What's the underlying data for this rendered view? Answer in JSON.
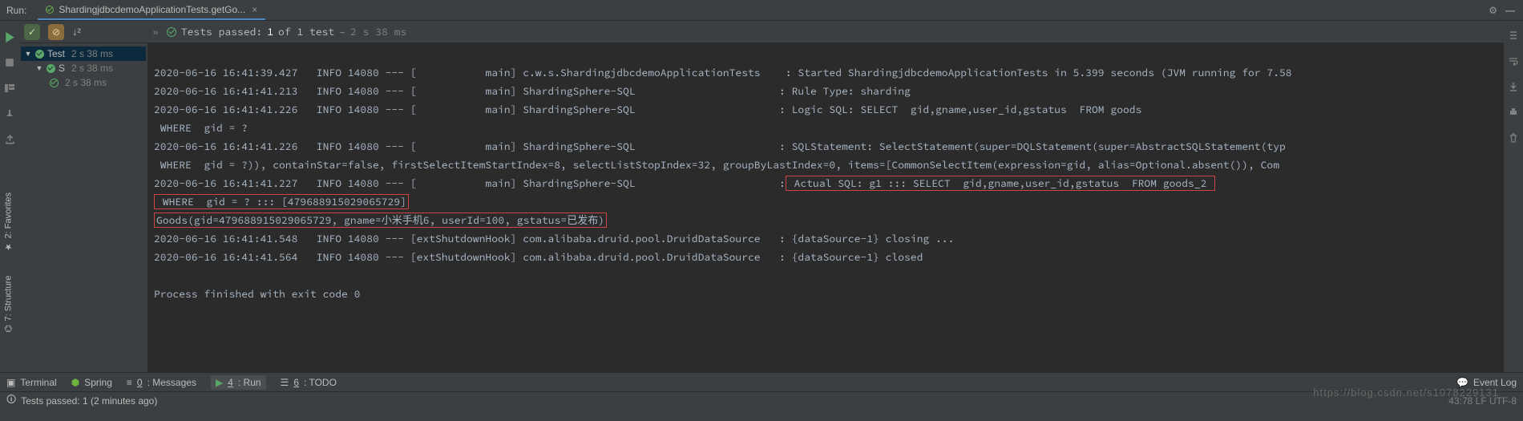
{
  "header": {
    "run_label": "Run:",
    "tab_title": "ShardingjdbcdemoApplicationTests.getGo...",
    "close": "×",
    "gear": "⚙",
    "min": "—"
  },
  "summary": {
    "prefix": "Tests passed:",
    "count": "1",
    "of": "of 1 test",
    "dash": "–",
    "duration": "2 s 38 ms",
    "sort": "↓²",
    "arrows": "»"
  },
  "tree": {
    "root": {
      "label": "Test",
      "duration": "2 s 38 ms"
    },
    "child": {
      "label": "S",
      "duration": "2 s 38 ms"
    },
    "leaf": {
      "duration": "2 s 38 ms"
    }
  },
  "console": {
    "l1": "2020-06-16 16:41:39.427   INFO 14080 --- [           main] c.w.s.ShardingjdbcdemoApplicationTests    : Started ShardingjdbcdemoApplicationTests in 5.399 seconds (JVM running for 7.58",
    "l2": "2020-06-16 16:41:41.213   INFO 14080 --- [           main] ShardingSphere-SQL                       : Rule Type: sharding",
    "l3": "2020-06-16 16:41:41.226   INFO 14080 --- [           main] ShardingSphere-SQL                       : Logic SQL: SELECT  gid,gname,user_id,gstatus  FROM goods ",
    "l4": " WHERE  gid = ?",
    "l5": "2020-06-16 16:41:41.226   INFO 14080 --- [           main] ShardingSphere-SQL                       : SQLStatement: SelectStatement(super=DQLStatement(super=AbstractSQLStatement(typ",
    "l6": " WHERE  gid = ?)), containStar=false, firstSelectItemStartIndex=8, selectListStopIndex=32, groupByLastIndex=0, items=[CommonSelectItem(expression=gid, alias=Optional.absent()), Com",
    "l7a": "2020-06-16 16:41:41.227   INFO 14080 --- [           main] ShardingSphere-SQL                       :",
    "l7b": " Actual SQL: g1 ::: SELECT  gid,gname,user_id,gstatus  FROM goods_2 ",
    "l8": " WHERE  gid = ? ::: [479688915029065729]",
    "l9": "Goods(gid=479688915029065729, gname=小米手机6, userId=100, gstatus=已发布)",
    "l10": "2020-06-16 16:41:41.548   INFO 14080 --- [extShutdownHook] com.alibaba.druid.pool.DruidDataSource   : {dataSource-1} closing ...",
    "l11": "2020-06-16 16:41:41.564   INFO 14080 --- [extShutdownHook] com.alibaba.druid.pool.DruidDataSource   : {dataSource-1} closed",
    "l12": "",
    "l13": "Process finished with exit code 0"
  },
  "bottom_tabs": {
    "terminal": "Terminal",
    "spring": "Spring",
    "messages_num": "0",
    "messages": ": Messages",
    "run_num": "4",
    "run": ": Run",
    "todo_num": "6",
    "todo": ": TODO",
    "event_log": "Event Log"
  },
  "status": {
    "msg": "Tests passed: 1 (2 minutes ago)",
    "right": "43:78   LF   UTF-8"
  },
  "side": {
    "fav": "2: Favorites",
    "struct": "7: Structure"
  },
  "watermark": "https://blog.csdn.net/s1078229131"
}
